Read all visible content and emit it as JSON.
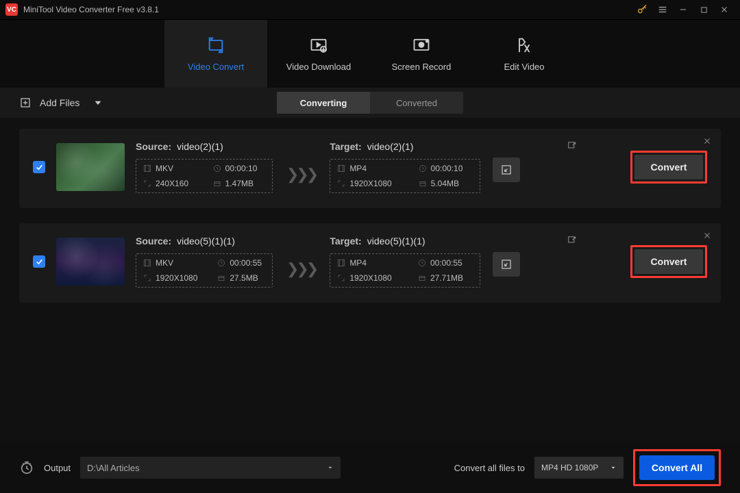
{
  "app": {
    "logo_text": "VC",
    "title": "MiniTool Video Converter Free v3.8.1"
  },
  "nav": {
    "convert": "Video Convert",
    "download": "Video Download",
    "record": "Screen Record",
    "edit": "Edit Video"
  },
  "toolbar": {
    "add_files": "Add Files",
    "seg_converting": "Converting",
    "seg_converted": "Converted"
  },
  "rows": [
    {
      "source_name": "video(2)(1)",
      "target_name": "video(2)(1)",
      "src_fmt": "MKV",
      "src_dur": "00:00:10",
      "src_res": "240X160",
      "src_size": "1.47MB",
      "tgt_fmt": "MP4",
      "tgt_dur": "00:00:10",
      "tgt_res": "1920X1080",
      "tgt_size": "5.04MB",
      "convert_label": "Convert"
    },
    {
      "source_name": "video(5)(1)(1)",
      "target_name": "video(5)(1)(1)",
      "src_fmt": "MKV",
      "src_dur": "00:00:55",
      "src_res": "1920X1080",
      "src_size": "27.5MB",
      "tgt_fmt": "MP4",
      "tgt_dur": "00:00:55",
      "tgt_res": "1920X1080",
      "tgt_size": "27.71MB",
      "convert_label": "Convert"
    }
  ],
  "labels": {
    "source": "Source:",
    "target": "Target:"
  },
  "footer": {
    "output_label": "Output",
    "output_path": "D:\\All Articles",
    "all_files_label": "Convert all files to",
    "format_preset": "MP4 HD 1080P",
    "convert_all": "Convert All"
  }
}
